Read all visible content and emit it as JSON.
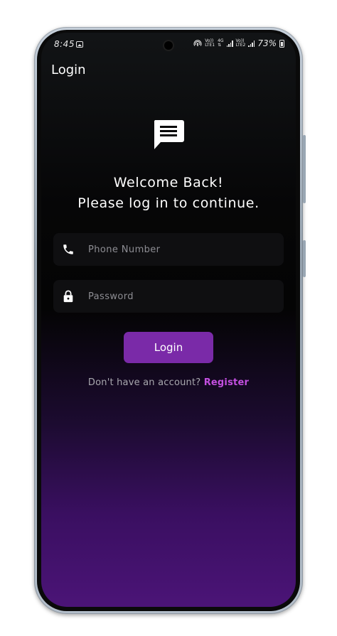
{
  "status_bar": {
    "time": "8:45",
    "network_top_1": "Vo))",
    "network_bottom_1": "LTE1",
    "network_top_2": "4G",
    "network_top_3": "Vo))",
    "network_bottom_3": "LTE2",
    "battery_percent": "73%"
  },
  "app_bar": {
    "title": "Login"
  },
  "welcome": {
    "line1": "Welcome Back!",
    "line2": "Please log in to continue."
  },
  "form": {
    "phone_placeholder": "Phone Number",
    "phone_value": "",
    "password_placeholder": "Password",
    "password_value": "",
    "login_label": "Login"
  },
  "register": {
    "prompt": "Don't have an account? ",
    "link": "Register"
  },
  "icons": {
    "header": "message-icon",
    "phone": "phone-icon",
    "password": "lock-icon"
  },
  "colors": {
    "accent": "#7a2aa8",
    "link": "#c34fe0",
    "gradient_bottom": "#4b1477",
    "background_top": "#121416"
  }
}
